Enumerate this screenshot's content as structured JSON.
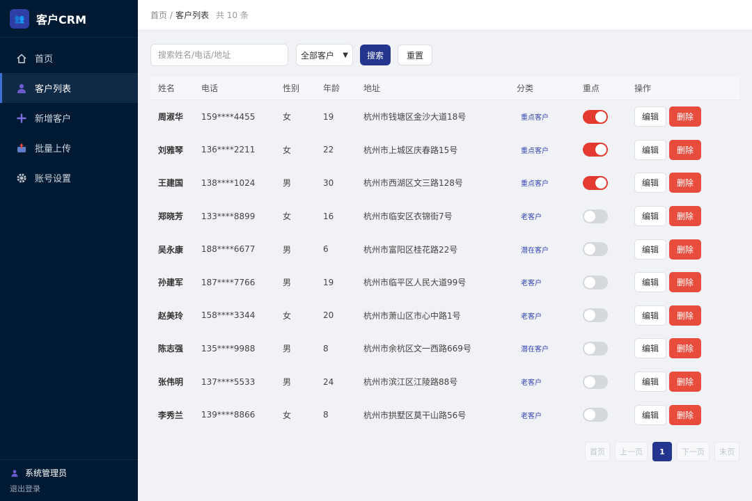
{
  "app": {
    "logo_text": "👥",
    "name": "客户CRM"
  },
  "nav": [
    {
      "icon": "home-icon",
      "label": "首页",
      "active": false
    },
    {
      "icon": "user-icon",
      "label": "客户列表",
      "active": true
    },
    {
      "icon": "plus-icon",
      "label": "新增客户",
      "active": false
    },
    {
      "icon": "upload-icon",
      "label": "批量上传",
      "active": false
    },
    {
      "icon": "gear-icon",
      "label": "账号设置",
      "active": false
    }
  ],
  "footer": {
    "user": "系统管理员",
    "logout": "退出登录"
  },
  "breadcrumb": {
    "home": "首页",
    "sep": "/",
    "current": "客户列表",
    "total": "共 10 条"
  },
  "search": {
    "placeholder": "搜索姓名/电话/地址",
    "value": ""
  },
  "filter": {
    "selected": "全部客户"
  },
  "buttons": {
    "search": "搜索",
    "reset": "重置"
  },
  "table": {
    "headers": {
      "name": "姓名",
      "phone": "电话",
      "gender": "性别",
      "age": "年龄",
      "address": "地址",
      "category": "分类",
      "key": "重点",
      "actions": "操作"
    },
    "edit_label": "编辑",
    "delete_label": "删除",
    "rows": [
      {
        "name": "周淑华",
        "phone": "159****4455",
        "gender": "女",
        "age": "19",
        "address": "杭州市钱塘区金沙大道18号",
        "category": "重点客户",
        "key": true
      },
      {
        "name": "刘雅琴",
        "phone": "136****2211",
        "gender": "女",
        "age": "22",
        "address": "杭州市上城区庆春路15号",
        "category": "重点客户",
        "key": true
      },
      {
        "name": "王建国",
        "phone": "138****1024",
        "gender": "男",
        "age": "30",
        "address": "杭州市西湖区文三路128号",
        "category": "重点客户",
        "key": true
      },
      {
        "name": "郑晓芳",
        "phone": "133****8899",
        "gender": "女",
        "age": "16",
        "address": "杭州市临安区衣锦街7号",
        "category": "老客户",
        "key": false
      },
      {
        "name": "吴永康",
        "phone": "188****6677",
        "gender": "男",
        "age": "6",
        "address": "杭州市富阳区桂花路22号",
        "category": "潜在客户",
        "key": false
      },
      {
        "name": "孙建军",
        "phone": "187****7766",
        "gender": "男",
        "age": "19",
        "address": "杭州市临平区人民大道99号",
        "category": "老客户",
        "key": false
      },
      {
        "name": "赵美玲",
        "phone": "158****3344",
        "gender": "女",
        "age": "20",
        "address": "杭州市萧山区市心中路1号",
        "category": "老客户",
        "key": false
      },
      {
        "name": "陈志强",
        "phone": "135****9988",
        "gender": "男",
        "age": "8",
        "address": "杭州市余杭区文一西路669号",
        "category": "潜在客户",
        "key": false
      },
      {
        "name": "张伟明",
        "phone": "137****5533",
        "gender": "男",
        "age": "24",
        "address": "杭州市滨江区江陵路88号",
        "category": "老客户",
        "key": false
      },
      {
        "name": "李秀兰",
        "phone": "139****8866",
        "gender": "女",
        "age": "8",
        "address": "杭州市拱墅区莫干山路56号",
        "category": "老客户",
        "key": false
      }
    ]
  },
  "pagination": {
    "first": "首页",
    "prev": "上一页",
    "current": "1",
    "next": "下一页",
    "last": "末页"
  },
  "colors": {
    "sidebar_bg": "#001a33",
    "primary": "#23358f",
    "danger": "#e84c3d",
    "switch_on": "#e33a32",
    "tag": "#3646b5"
  }
}
